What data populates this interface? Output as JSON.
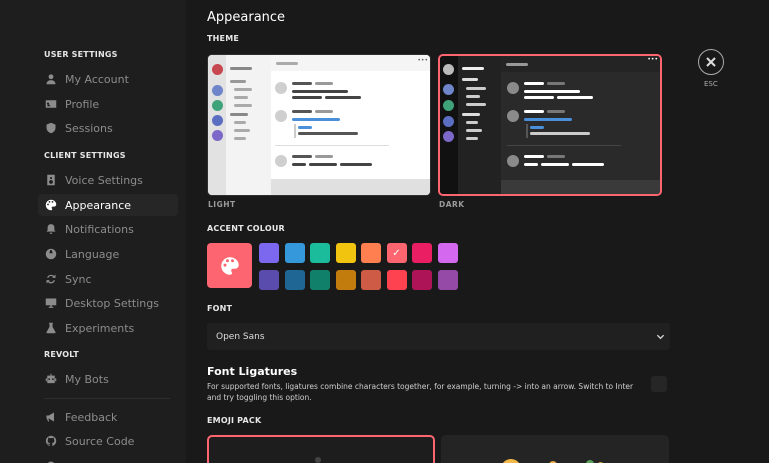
{
  "sidebar": {
    "sections": [
      {
        "label": "USER SETTINGS",
        "items": [
          {
            "label": "My Account",
            "icon": "user-icon"
          },
          {
            "label": "Profile",
            "icon": "id-card-icon"
          },
          {
            "label": "Sessions",
            "icon": "shield-icon"
          }
        ]
      },
      {
        "label": "CLIENT SETTINGS",
        "items": [
          {
            "label": "Voice Settings",
            "icon": "speaker-icon"
          },
          {
            "label": "Appearance",
            "icon": "palette-icon",
            "active": true
          },
          {
            "label": "Notifications",
            "icon": "bell-icon"
          },
          {
            "label": "Language",
            "icon": "globe-icon"
          },
          {
            "label": "Sync",
            "icon": "sync-icon"
          },
          {
            "label": "Desktop Settings",
            "icon": "monitor-icon"
          },
          {
            "label": "Experiments",
            "icon": "flask-icon"
          }
        ]
      },
      {
        "label": "REVOLT",
        "items": [
          {
            "label": "My Bots",
            "icon": "robot-icon"
          }
        ]
      }
    ],
    "extra_items": [
      {
        "label": "Feedback",
        "icon": "megaphone-icon"
      },
      {
        "label": "Source Code",
        "icon": "github-icon"
      }
    ]
  },
  "main": {
    "title": "Appearance",
    "theme_label": "THEME",
    "themes": [
      {
        "label": "LIGHT"
      },
      {
        "label": "DARK",
        "selected": true
      }
    ],
    "accent_label": "ACCENT COLOUR",
    "accent_selected": "#fd6671",
    "accent_colors_top": [
      "#7b68ee",
      "#3498db",
      "#1abc9c",
      "#f1c40f",
      "#ff7f50",
      "#fd6671",
      "#e91e63",
      "#d468ee"
    ],
    "accent_colors_bottom": [
      "#594cad",
      "#206694",
      "#11806a",
      "#c27c0e",
      "#cd5b45",
      "#ff424f",
      "#ad1457",
      "#954aa8"
    ],
    "font_label": "FONT",
    "font_value": "Open Sans",
    "ligatures_title": "Font Ligatures",
    "ligatures_desc": "For supported fonts, ligatures combine characters together, for example, turning -> into an arrow. Switch to Inter and try toggling this option.",
    "emoji_label": "EMOJI PACK",
    "close_label": "ESC"
  }
}
